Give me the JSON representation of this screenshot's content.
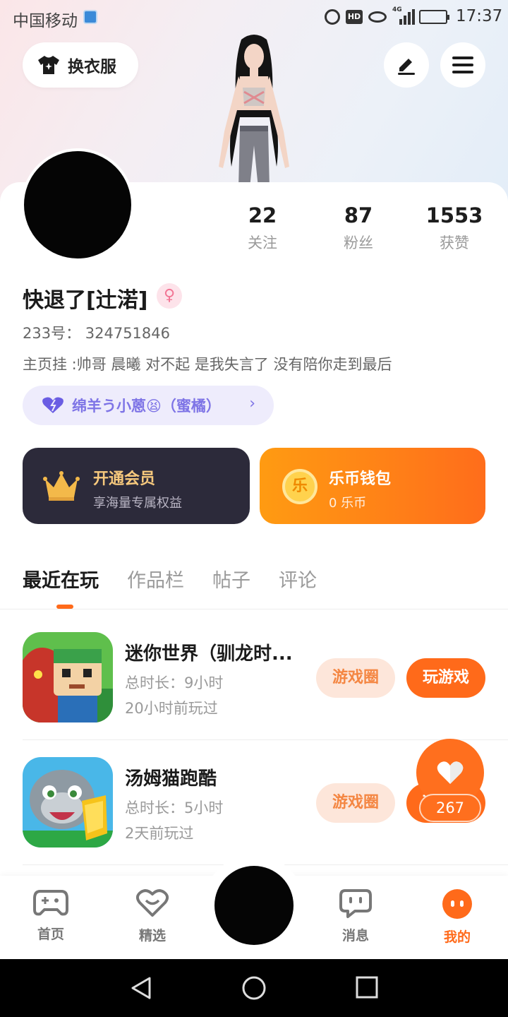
{
  "status_bar": {
    "carrier": "中国移动",
    "hd": "HD",
    "network": "4G",
    "time": "17:37"
  },
  "header": {
    "outfit_label": "换衣服",
    "edit_icon": "pencil-icon",
    "menu_icon": "hamburger-icon"
  },
  "stats": [
    {
      "value": "22",
      "label": "关注"
    },
    {
      "value": "87",
      "label": "粉丝"
    },
    {
      "value": "1553",
      "label": "获赞"
    }
  ],
  "profile": {
    "username": "快退了[辻渃]",
    "gender_symbol": "♀",
    "uid": "233号：  324751846",
    "bio": "主页挂 :帅哥 晨曦  对不起 是我失言了 没有陪你走到最后",
    "relation_label": "绵羊う小蒽😫（蜜橘）",
    "relation_chevron": "›"
  },
  "vip": {
    "title": "开通会员",
    "subtitle": "享海量专属权益"
  },
  "wallet": {
    "title": "乐币钱包",
    "subtitle": "0 乐币",
    "coin_glyph": "乐"
  },
  "tabs": [
    "最近在玩",
    "作品栏",
    "帖子",
    "评论"
  ],
  "games": [
    {
      "name": "迷你世界（驯龙时...",
      "duration": "总时长：9小时",
      "last_played": "20小时前玩过",
      "circle_label": "游戏圈",
      "play_label": "玩游戏"
    },
    {
      "name": "汤姆猫跑酷",
      "duration": "总时长：5小时",
      "last_played": "2天前玩过",
      "circle_label": "游戏圈",
      "play_label": "玩游戏"
    }
  ],
  "like": {
    "count": "267"
  },
  "nav": [
    {
      "label": "首页",
      "icon": "gamepad-icon"
    },
    {
      "label": "精选",
      "icon": "heart-chat-icon"
    },
    {
      "label": "消息",
      "icon": "message-icon"
    },
    {
      "label": "我的",
      "icon": "profile-dots-icon"
    }
  ],
  "colors": {
    "accent": "#ff6a1a",
    "relation": "#7e74e6",
    "vip_bg": "#2c2a3a",
    "vip_text": "#f7c97d"
  }
}
